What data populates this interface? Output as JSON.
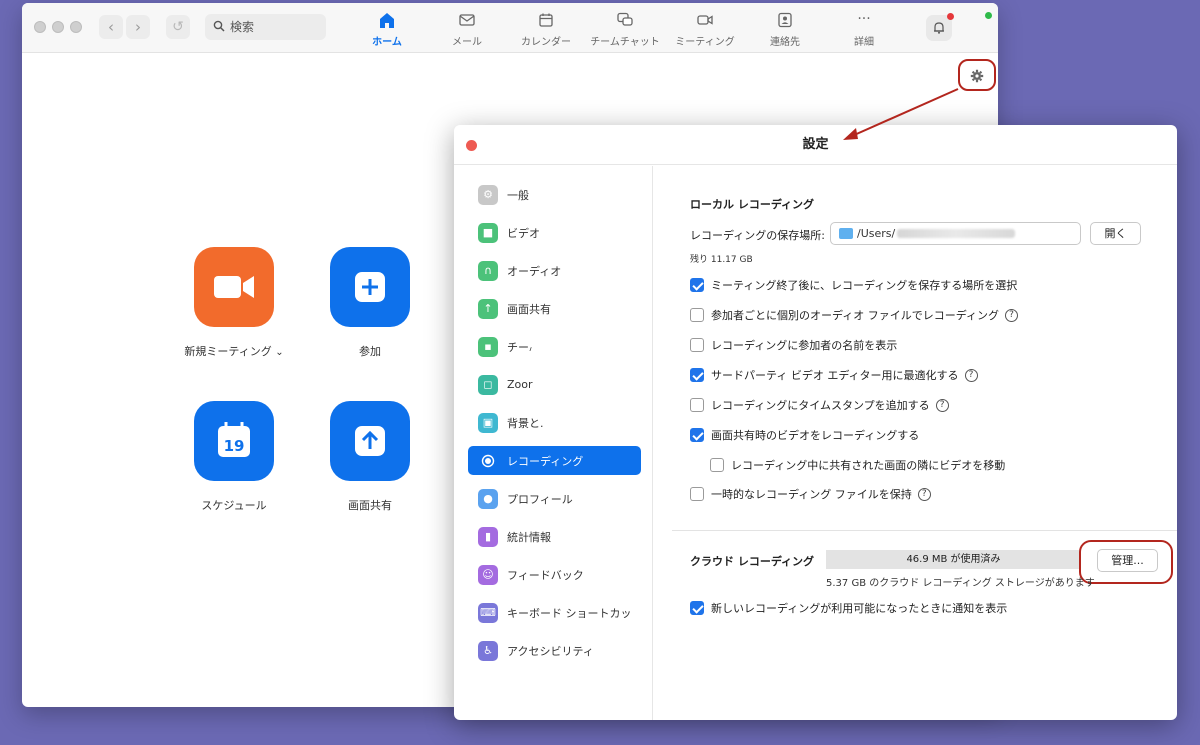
{
  "toolbar": {
    "search_placeholder": "検索",
    "tabs": [
      {
        "label": "ホーム",
        "icon": "home-icon",
        "active": true
      },
      {
        "label": "メール",
        "icon": "mail-icon"
      },
      {
        "label": "カレンダー",
        "icon": "calendar-icon"
      },
      {
        "label": "チームチャット",
        "icon": "chat-icon"
      },
      {
        "label": "ミーティング",
        "icon": "video-icon"
      },
      {
        "label": "連絡先",
        "icon": "contacts-icon"
      },
      {
        "label": "詳細",
        "icon": "more-icon"
      }
    ],
    "more_glyph": "···"
  },
  "home": {
    "tiles": [
      {
        "label": "新規ミーティング",
        "color": "#f26b2c",
        "icon": "video-camera-icon"
      },
      {
        "label": "参加",
        "color": "#0e71eb",
        "icon": "plus-icon"
      },
      {
        "label": "スケジュール",
        "color": "#0e71eb",
        "icon": "calendar-icon",
        "day": "19"
      },
      {
        "label": "画面共有",
        "color": "#0e71eb",
        "icon": "share-up-arrow-icon"
      }
    ],
    "new_meeting_chevron": "⌄"
  },
  "settings": {
    "title": "設定",
    "nav": [
      {
        "label": "一般",
        "icon": "gear-icon",
        "color": "#c8c8c8"
      },
      {
        "label": "ビデオ",
        "icon": "video-icon",
        "color": "#4cc27a"
      },
      {
        "label": "オーディオ",
        "icon": "headphones-icon",
        "color": "#4cc27a"
      },
      {
        "label": "画面共有",
        "icon": "screen-share-icon",
        "color": "#4cc27a"
      },
      {
        "label": "チー៸",
        "icon": "chat-icon",
        "color": "#4cc27a"
      },
      {
        "label": "Zoor",
        "icon": "apps-icon",
        "color": "#3bb9a0"
      },
      {
        "label": "背景と.",
        "icon": "background-icon",
        "color": "#3fb8d1"
      },
      {
        "label": "レコーディング",
        "icon": "record-icon",
        "color": "#ffffff",
        "active": true
      },
      {
        "label": "プロフィール",
        "icon": "profile-icon",
        "color": "#5aa2ef"
      },
      {
        "label": "統計情報",
        "icon": "statistics-icon",
        "color": "#a46be0"
      },
      {
        "label": "フィードバック",
        "icon": "feedback-icon",
        "color": "#a46be0"
      },
      {
        "label": "キーボード ショートカッ",
        "icon": "keyboard-icon",
        "color": "#7a77d9"
      },
      {
        "label": "アクセシビリティ",
        "icon": "accessibility-icon",
        "color": "#7a77d9"
      }
    ],
    "local": {
      "title": "ローカル レコーディング",
      "location_label": "レコーディングの保存場所:",
      "path_prefix": "/Users/",
      "open_button": "開く",
      "remaining": "残り 11.17 GB",
      "options": [
        {
          "label": "ミーティング終了後に、レコーディングを保存する場所を選択",
          "checked": true,
          "help": false
        },
        {
          "label": "参加者ごとに個別のオーディオ ファイルでレコーディング",
          "checked": false,
          "help": true
        },
        {
          "label": "レコーディングに参加者の名前を表示",
          "checked": false,
          "help": false
        },
        {
          "label": "サードパーティ ビデオ エディター用に最適化する",
          "checked": true,
          "help": true
        },
        {
          "label": "レコーディングにタイムスタンプを追加する",
          "checked": false,
          "help": true
        },
        {
          "label": "画面共有時のビデオをレコーディングする",
          "checked": true,
          "help": false
        },
        {
          "label": "レコーディング中に共有された画面の隣にビデオを移動",
          "checked": false,
          "help": false,
          "indent": true
        },
        {
          "label": "一時的なレコーディング ファイルを保持",
          "checked": false,
          "help": true
        }
      ],
      "help_glyph": "?"
    },
    "cloud": {
      "title": "クラウド レコーディング",
      "usage": "46.9 MB が使用済み",
      "usage_fraction": 0.01,
      "manage_button": "管理...",
      "storage": "5.37 GB のクラウド レコーディング ストレージがあります",
      "notify": {
        "label": "新しいレコーディングが利用可能になったときに通知を表示",
        "checked": true
      }
    }
  },
  "colors": {
    "accent": "#0e71eb",
    "annotation": "#b3261e",
    "desktop": "#6b69b4"
  }
}
